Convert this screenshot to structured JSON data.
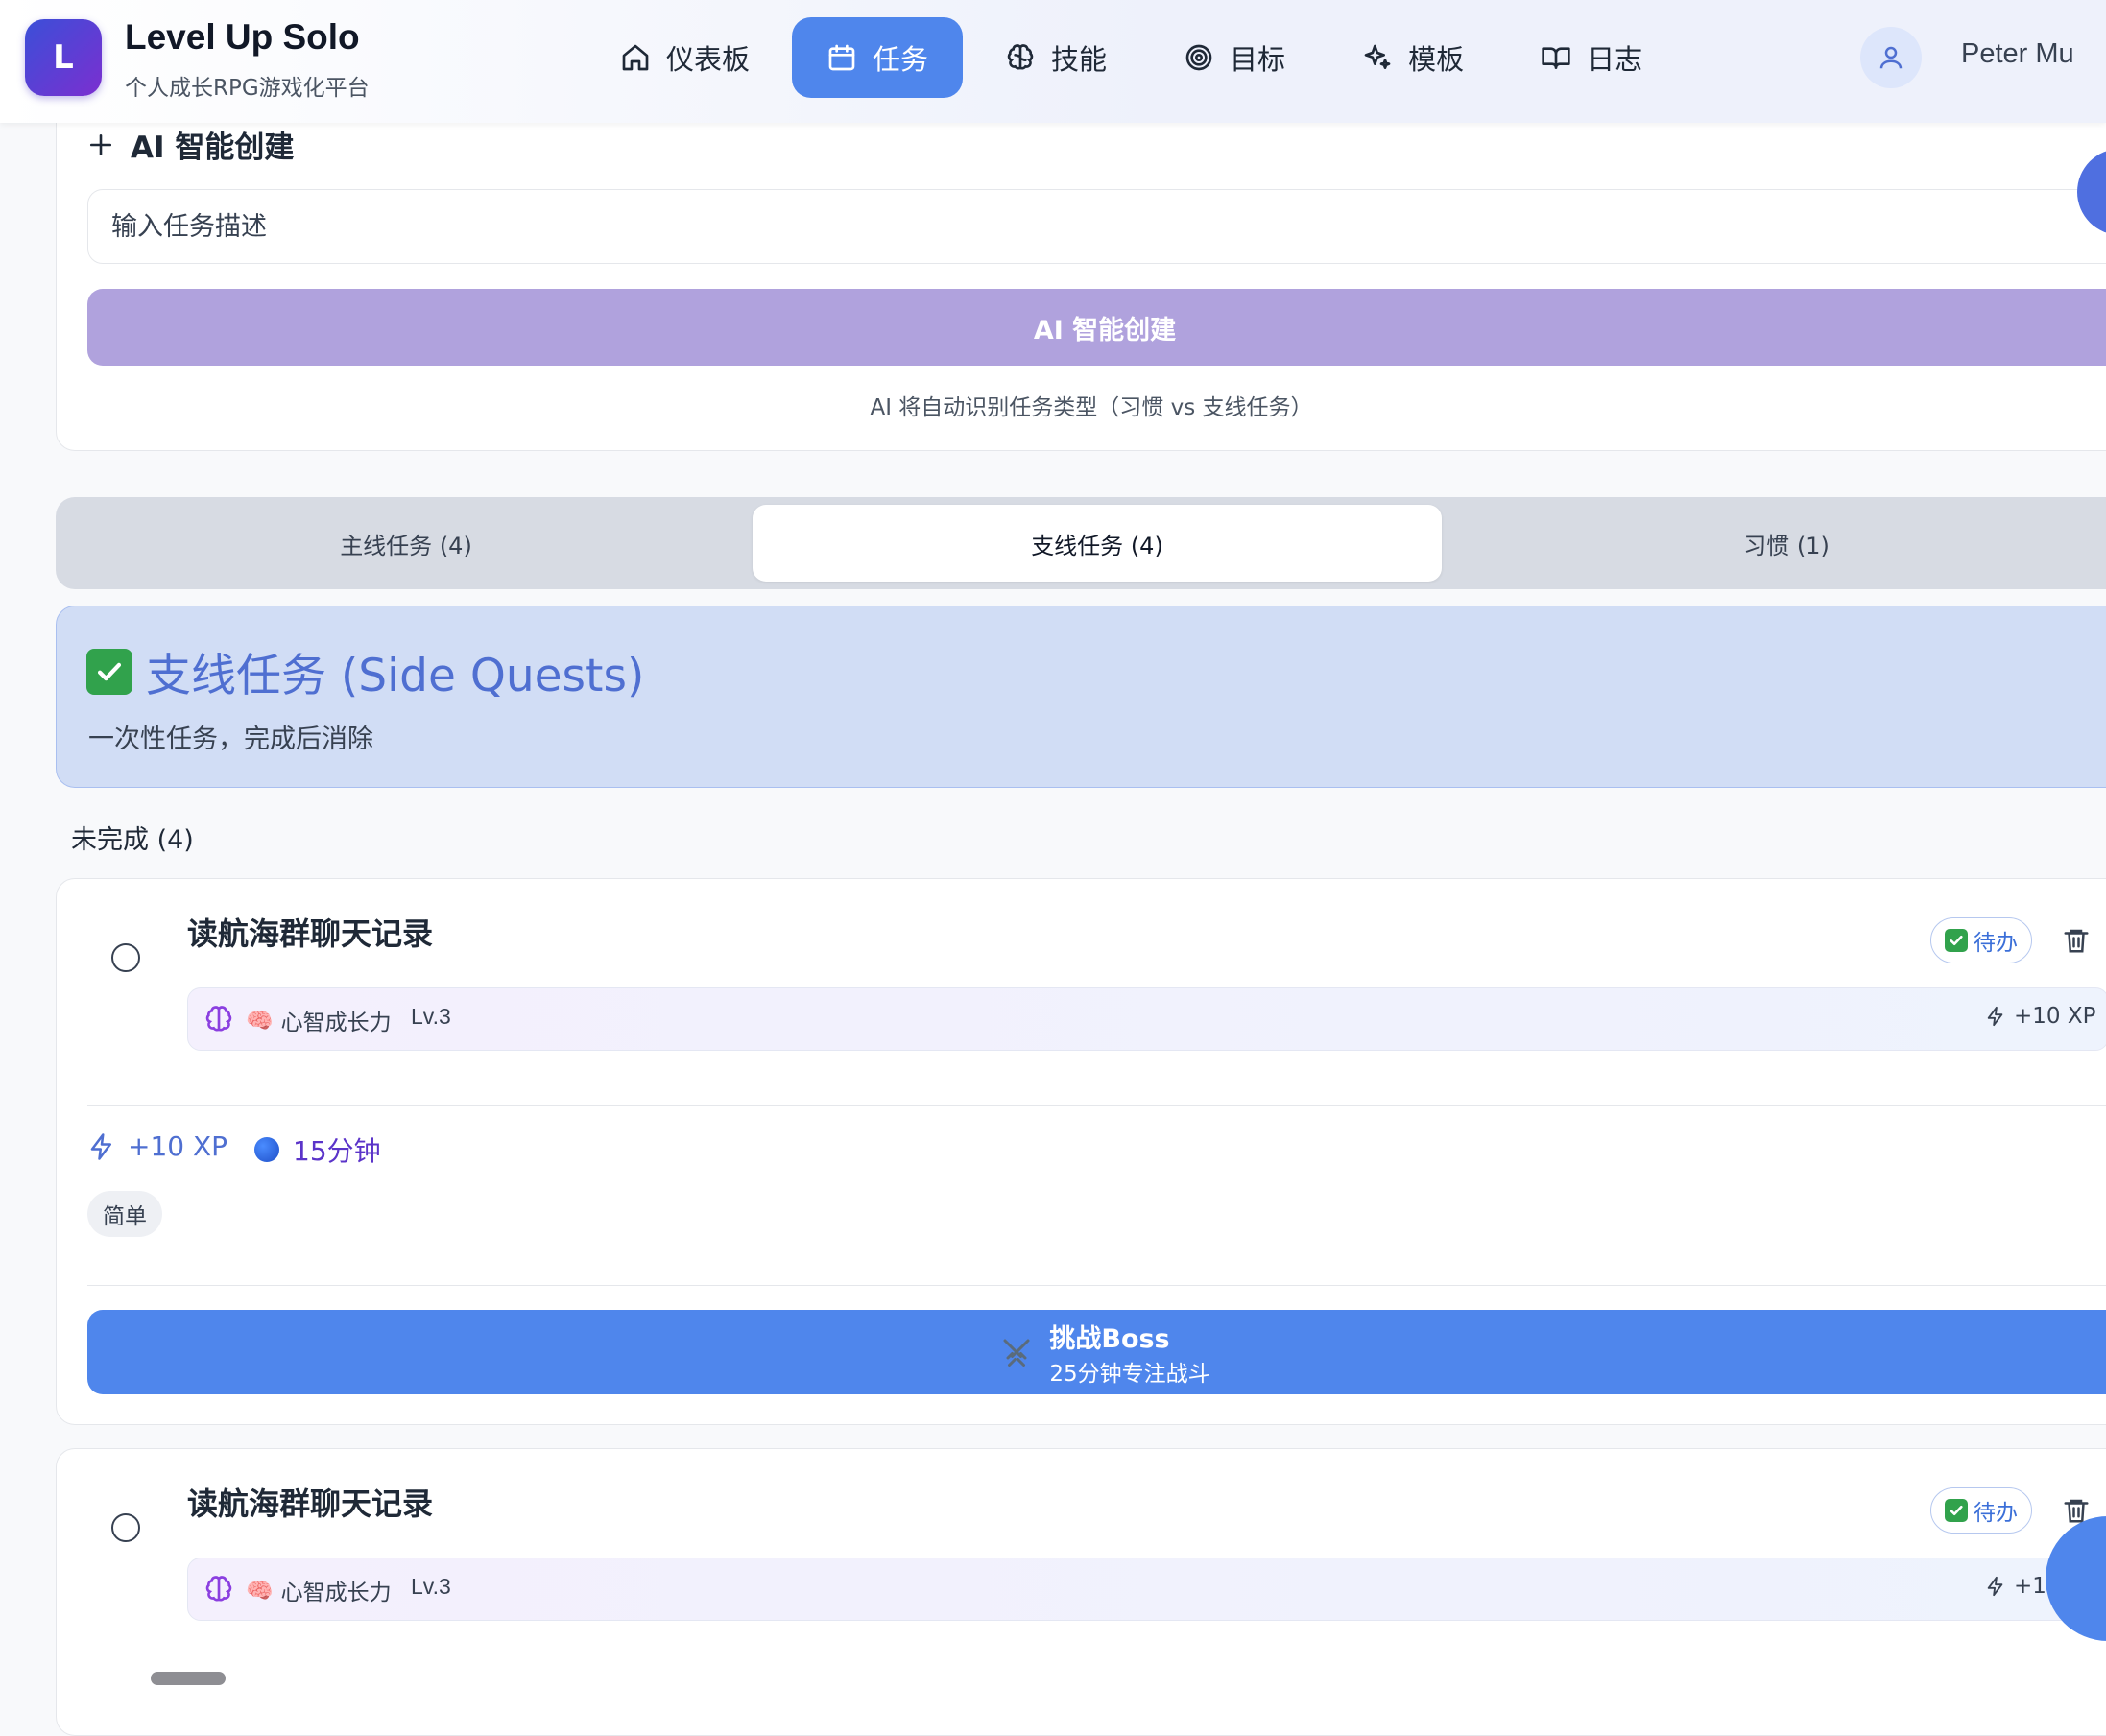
{
  "app": {
    "logo_letter": "L",
    "title": "Level Up Solo",
    "subtitle": "个人成长RPG游戏化平台"
  },
  "nav": [
    {
      "label": "仪表板",
      "icon": "home-icon",
      "active": false
    },
    {
      "label": "任务",
      "icon": "calendar-icon",
      "active": true
    },
    {
      "label": "技能",
      "icon": "brain-icon",
      "active": false
    },
    {
      "label": "目标",
      "icon": "target-icon",
      "active": false
    },
    {
      "label": "模板",
      "icon": "sparkles-icon",
      "active": false
    },
    {
      "label": "日志",
      "icon": "book-icon",
      "active": false
    }
  ],
  "user": {
    "name": "Peter Mu"
  },
  "ai_create": {
    "heading": "AI 智能创建",
    "input_placeholder": "输入任务描述",
    "button_label": "AI 智能创建",
    "hint": "AI 将自动识别任务类型（习惯 vs 支线任务）"
  },
  "tabs": [
    {
      "label": "主线任务 (4)",
      "active": false
    },
    {
      "label": "支线任务 (4)",
      "active": true
    },
    {
      "label": "习惯 (1)",
      "active": false
    }
  ],
  "section": {
    "title": "支线任务 (Side Quests)",
    "description": "一次性任务，完成后消除"
  },
  "pending": {
    "label": "未完成 (4)"
  },
  "tasks": [
    {
      "title": "读航海群聊天记录",
      "status": "待办",
      "skill": {
        "emoji": "🧠",
        "name": "心智成长力",
        "level": "Lv.3",
        "xp": "+10 XP"
      },
      "xp": "+10 XP",
      "duration": "15分钟",
      "difficulty": "简单",
      "boss": {
        "title": "挑战Boss",
        "subtitle": "25分钟专注战斗"
      }
    },
    {
      "title": "读航海群聊天记录",
      "status": "待办",
      "skill": {
        "emoji": "🧠",
        "name": "心智成长力",
        "level": "Lv.3",
        "xp": "+10 XP"
      }
    }
  ],
  "colors": {
    "accent": "#4f86ec",
    "ai_button": "#b0a2dd",
    "banner_bg": "#d1ddf5",
    "banner_text": "#4f6fd1",
    "duration_text": "#5b34c9"
  }
}
